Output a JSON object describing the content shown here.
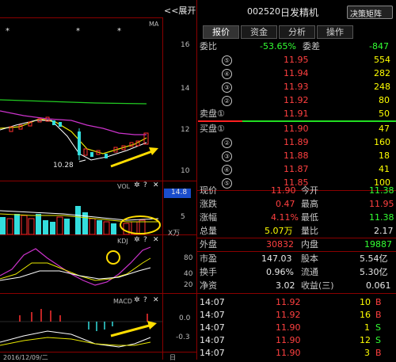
{
  "left": {
    "expand_label": "<<展开",
    "ma_label": "MA",
    "price_axis": [
      "16",
      "14",
      "12",
      "10"
    ],
    "low_label": "10.28",
    "vol_label": "VOL",
    "vol_axis": [
      "5",
      "X万"
    ],
    "vol_value_box": "14.8",
    "kdj_label": "KDJ",
    "kdj_axis": [
      "80",
      "40",
      "20"
    ],
    "macd_label": "MACD",
    "macd_axis": [
      "0.0",
      "-0.3"
    ],
    "date_label": "2016/12/09/二",
    "bottom_label": "日"
  },
  "header": {
    "code": "002520",
    "name": "日发精机",
    "matrix_button": "决策矩阵"
  },
  "tabs": [
    "报价",
    "资金",
    "分析",
    "操作"
  ],
  "ratio": {
    "label1": "委比",
    "value1": "-53.65%",
    "label2": "委差",
    "value2": "-847"
  },
  "asks": [
    {
      "n": "⑤",
      "price": "11.95",
      "vol": "554"
    },
    {
      "n": "④",
      "price": "11.94",
      "vol": "282"
    },
    {
      "n": "③",
      "price": "11.93",
      "vol": "248"
    },
    {
      "n": "②",
      "price": "11.92",
      "vol": "80"
    }
  ],
  "ask1": {
    "label": "卖盘①",
    "price": "11.91",
    "vol": "50"
  },
  "bid1": {
    "label": "买盘①",
    "price": "11.90",
    "vol": "47"
  },
  "bids": [
    {
      "n": "②",
      "price": "11.89",
      "vol": "160"
    },
    {
      "n": "③",
      "price": "11.88",
      "vol": "18"
    },
    {
      "n": "④",
      "price": "11.87",
      "vol": "41"
    },
    {
      "n": "⑤",
      "price": "11.85",
      "vol": "100"
    }
  ],
  "stats": [
    {
      "l1": "现价",
      "v1": "11.90",
      "l2": "今开",
      "v2": "11.38"
    },
    {
      "l1": "涨跌",
      "v1": "0.47",
      "l2": "最高",
      "v2": "11.95"
    },
    {
      "l1": "涨幅",
      "v1": "4.11%",
      "l2": "最低",
      "v2": "11.38"
    },
    {
      "l1": "总量",
      "v1": "5.07万",
      "l2": "量比",
      "v2": "2.17"
    },
    {
      "l1": "外盘",
      "v1": "30832",
      "l2": "内盘",
      "v2": "19887"
    },
    {
      "l1": "市盈",
      "v1": "147.03",
      "l2": "股本",
      "v2": "5.54亿"
    },
    {
      "l1": "换手",
      "v1": "0.96%",
      "l2": "流通",
      "v2": "5.30亿"
    },
    {
      "l1": "净资",
      "v1": "3.02",
      "l2": "收益(三)",
      "v2": "0.061"
    }
  ],
  "trades": [
    {
      "time": "14:07",
      "price": "11.92",
      "vol": "10",
      "dir": "B"
    },
    {
      "time": "14:07",
      "price": "11.92",
      "vol": "16",
      "dir": "B"
    },
    {
      "time": "14:07",
      "price": "11.90",
      "vol": "1",
      "dir": "S"
    },
    {
      "time": "14:07",
      "price": "11.90",
      "vol": "12",
      "dir": "S"
    },
    {
      "time": "14:07",
      "price": "11.90",
      "vol": "3",
      "dir": "B"
    }
  ]
}
